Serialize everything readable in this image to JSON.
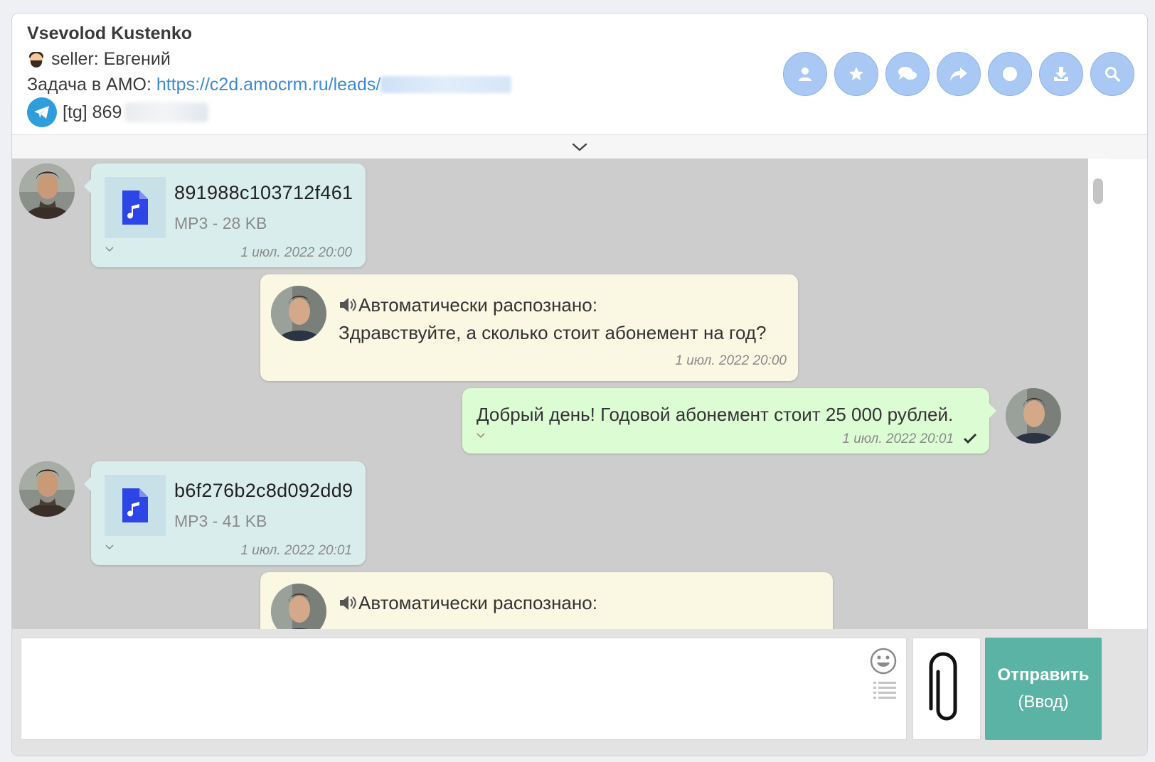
{
  "header": {
    "contact_name": "Vsevolod Kustenko",
    "seller": "seller: Евгений",
    "task_label": "Задача в АМО: ",
    "task_link": "https://c2d.amocrm.ru/leads/",
    "tg_label": "[tg] 869"
  },
  "actions": [
    {
      "icon": "user-icon"
    },
    {
      "icon": "star-icon"
    },
    {
      "icon": "comments-icon"
    },
    {
      "icon": "share-icon"
    },
    {
      "icon": "record-icon"
    },
    {
      "icon": "download-icon"
    },
    {
      "icon": "search-icon"
    }
  ],
  "messages": [
    {
      "type": "file",
      "direction": "incoming",
      "file_name": "891988c103712f461",
      "file_meta": "MP3 - 28 KB",
      "time": "1 июл. 2022 20:00"
    },
    {
      "type": "auto",
      "direction": "incoming",
      "title": "Автоматически распознано:",
      "text": "Здравствуйте, а сколько стоит абонемент на год?",
      "time": "1 июл. 2022 20:00"
    },
    {
      "type": "text",
      "direction": "outgoing",
      "text": "Добрый день! Годовой абонемент стоит 25 000 рублей.",
      "time": "1 июл. 2022 20:01",
      "status": "check-icon"
    },
    {
      "type": "file",
      "direction": "incoming",
      "file_name": "b6f276b2c8d092dd9",
      "file_meta": "MP3 - 41 KB",
      "time": "1 июл. 2022 20:01"
    },
    {
      "type": "auto",
      "direction": "incoming",
      "title": "Автоматически распознано:",
      "text": "",
      "time": ""
    }
  ],
  "composer": {
    "placeholder": "",
    "send_label": "Отправить",
    "send_hint": "(Ввод)"
  },
  "colors": {
    "action_button": "#a9c8f4",
    "incoming_bubble": "#d9eeec",
    "auto_bubble": "#faf7e3",
    "outgoing_bubble": "#dcfcd4",
    "send_button": "#5bb3a5",
    "chat_background": "#cdcdcd",
    "link": "#3d89d6"
  }
}
